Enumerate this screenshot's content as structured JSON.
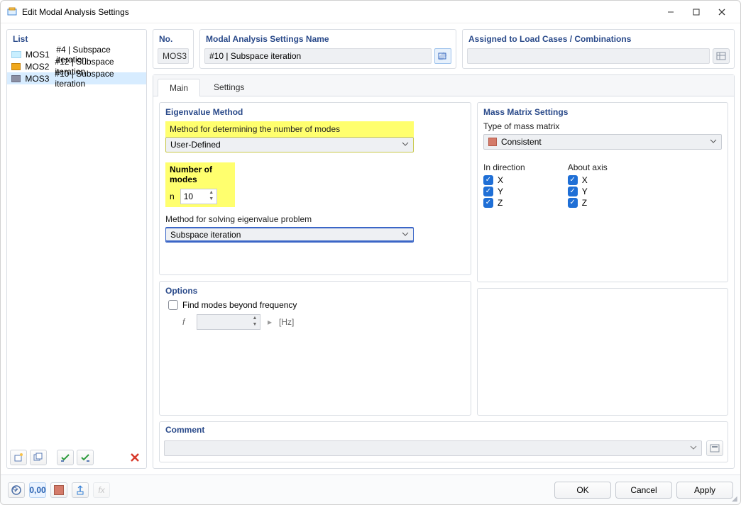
{
  "window": {
    "title": "Edit Modal Analysis Settings"
  },
  "list": {
    "header": "List",
    "items": [
      {
        "code": "MOS1",
        "label": "#4 | Subspace iteration",
        "color": "#c9efff"
      },
      {
        "code": "MOS2",
        "label": "#12 | Subspace iteration",
        "color": "#f0a81b"
      },
      {
        "code": "MOS3",
        "label": "#10 | Subspace iteration",
        "color": "#8b8fa3"
      }
    ],
    "selected_index": 2
  },
  "no": {
    "header": "No.",
    "value": "MOS3"
  },
  "name": {
    "header": "Modal Analysis Settings Name",
    "value": "#10 | Subspace iteration"
  },
  "assigned": {
    "header": "Assigned to Load Cases / Combinations"
  },
  "tabs": {
    "main": "Main",
    "settings": "Settings",
    "active": "main"
  },
  "eigen": {
    "header": "Eigenvalue Method",
    "method_label": "Method for determining the number of modes",
    "method_value": "User-Defined",
    "modes_label": "Number of modes",
    "n_symbol": "n",
    "n_value": "10",
    "solver_label": "Method for solving eigenvalue problem",
    "solver_value": "Subspace iteration"
  },
  "mass": {
    "header": "Mass Matrix Settings",
    "type_label": "Type of mass matrix",
    "type_value": "Consistent",
    "swatch": "#d47b6a",
    "dir_label": "In direction",
    "axis_label": "About axis",
    "X": "X",
    "Y": "Y",
    "Z": "Z"
  },
  "options": {
    "header": "Options",
    "find_label": "Find modes beyond frequency",
    "f_symbol": "f",
    "unit": "[Hz]"
  },
  "comment": {
    "header": "Comment"
  },
  "footer": {
    "ok": "OK",
    "cancel": "Cancel",
    "apply": "Apply"
  },
  "status_000": "0,00"
}
